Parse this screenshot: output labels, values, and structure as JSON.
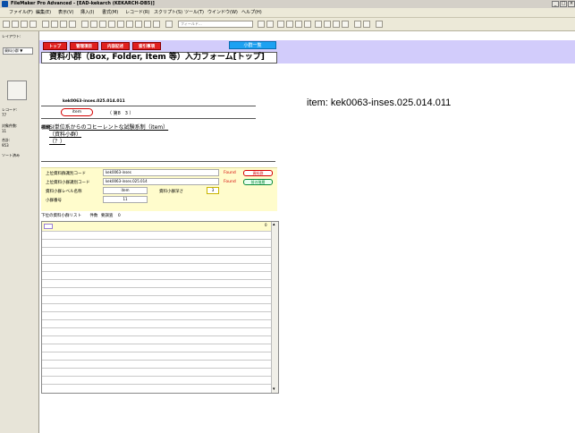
{
  "window": {
    "title": "FileMaker Pro Advanced - [EAD-kekarch (KEKARCH-DB5)]",
    "controls": [
      "_",
      "□",
      "×"
    ]
  },
  "menu": [
    "ファイル(F)",
    "編集(E)",
    "表示(V)",
    "挿入(I)",
    "書式(M)",
    "レコード(R)",
    "スクリプト(S)",
    "ツール(T)",
    "ウインドウ(W)",
    "ヘルプ(H)"
  ],
  "toolbar": {
    "search_placeholder": "フィールド..."
  },
  "status_area": {
    "layout_label": "レイアウト:",
    "layout_value": "資料小群 ▼",
    "record_label": "レコード:",
    "record_value": "77",
    "found_label": "対象件数:",
    "found_value": "11",
    "total_label": "合計:",
    "total_value": "953",
    "sort_label": "ソート済み"
  },
  "header": {
    "buttons": [
      "トップ",
      "管理項目",
      "内容記述",
      "索引事項"
    ],
    "list_button": "小群一覧",
    "form_title": "資料小群（Box, Folder, Item 等）入力フォーム[トップ]"
  },
  "record": {
    "code": "kek0063-inses.025.014.011",
    "level": "item",
    "level_part": "（ 第8　3 ）",
    "title_label": "標題",
    "title_lines": [
      "SI単位系からのコヒーレントな試験系制（item）",
      "（資料小群）",
      "（？）"
    ]
  },
  "item_line": "item: kek0063-inses.025.014.011",
  "info": {
    "parent_code_label": "上位資料群識別コード",
    "parent_code_value": "kek0063-inses",
    "parent_found": "Found",
    "parent_button": "資料群",
    "sub_code_label": "上位資料小群識別コード",
    "sub_code_value": "kek0063-inses.025.014",
    "sub_found": "Found",
    "sub_button": "前の階層",
    "level_name_label": "資料小群レベル名称",
    "level_name_value": "item",
    "depth_label": "資料小群深さ",
    "depth_value": "3",
    "number_label": "小群番号",
    "number_value": "11"
  },
  "children": {
    "header_label": "下位の資料小群リスト",
    "count_label": "件数",
    "count_sub_label": "要調査",
    "count_value": "0",
    "first_number": "0",
    "rows": 20
  },
  "colors": {
    "red": "#e02020",
    "blue": "#1da1f2",
    "lavender": "#d2ccfb",
    "pale_yellow": "#fffccc"
  }
}
